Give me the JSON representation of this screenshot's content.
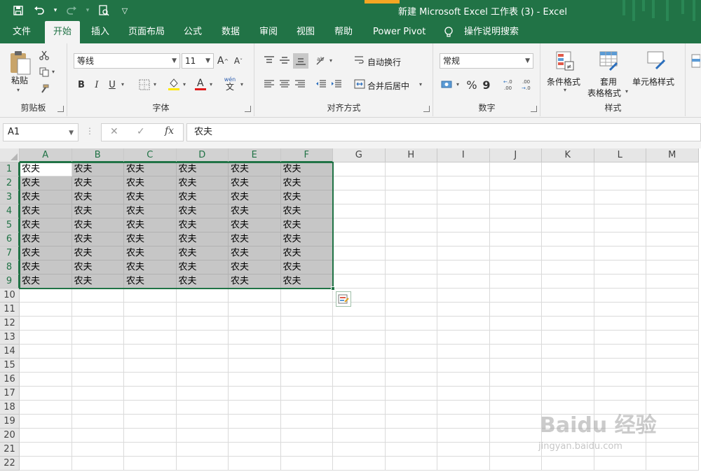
{
  "app": {
    "window_title": "新建 Microsoft Excel 工作表 (3)  -  Excel",
    "brand_color": "#217346"
  },
  "quick_access": [
    {
      "name": "save-icon",
      "glyph": "💾"
    },
    {
      "name": "undo-icon",
      "glyph": "↶"
    },
    {
      "name": "redo-icon",
      "glyph": "↷"
    },
    {
      "name": "print-preview-icon",
      "glyph": "🔍"
    },
    {
      "name": "customize-qat-icon",
      "glyph": "▽"
    }
  ],
  "tabs": [
    "文件",
    "开始",
    "插入",
    "页面布局",
    "公式",
    "数据",
    "审阅",
    "视图",
    "帮助",
    "Power Pivot"
  ],
  "active_tab": "开始",
  "tell_me": "操作说明搜索",
  "ribbon": {
    "clipboard": {
      "label": "剪贴板",
      "paste": "粘贴"
    },
    "font": {
      "label": "字体",
      "font_name": "等线",
      "font_size": "11",
      "bold": "B",
      "italic": "I",
      "underline": "U",
      "grow": "A",
      "shrink": "A",
      "phonetic_top": "wén",
      "phonetic_bottom": "文"
    },
    "alignment": {
      "label": "对齐方式",
      "wrap_text": "自动换行",
      "merge_center": "合并后居中"
    },
    "number": {
      "label": "数字",
      "format": "常规",
      "percent": "%",
      "comma": "9",
      "inc_decimal": "←.0\n.00",
      "dec_decimal": ".00\n→.0"
    },
    "styles": {
      "label": "样式",
      "conditional": "条件格式",
      "format_table_1": "套用",
      "format_table_2": "表格格式",
      "cell_styles": "单元格样式"
    }
  },
  "formula_bar": {
    "name_box": "A1",
    "cancel": "✕",
    "enter": "✓",
    "fx": "fx",
    "content": "农夫"
  },
  "sheet": {
    "columns": [
      "A",
      "B",
      "C",
      "D",
      "E",
      "F",
      "G",
      "H",
      "I",
      "J",
      "K",
      "L",
      "M"
    ],
    "rows": [
      "1",
      "2",
      "3",
      "4",
      "5",
      "6",
      "7",
      "8",
      "9",
      "10",
      "11",
      "12",
      "13",
      "14",
      "15",
      "16",
      "17",
      "18",
      "19",
      "20",
      "21",
      "22"
    ],
    "cells": [
      [
        "农夫",
        "农夫",
        "农夫",
        "农夫",
        "农夫",
        "农夫"
      ],
      [
        "农夫",
        "农夫",
        "农夫",
        "农夫",
        "农夫",
        "农夫"
      ],
      [
        "农夫",
        "农夫",
        "农夫",
        "农夫",
        "农夫",
        "农夫"
      ],
      [
        "农夫",
        "农夫",
        "农夫",
        "农夫",
        "农夫",
        "农夫"
      ],
      [
        "农夫",
        "农夫",
        "农夫",
        "农夫",
        "农夫",
        "农夫"
      ],
      [
        "农夫",
        "农夫",
        "农夫",
        "农夫",
        "农夫",
        "农夫"
      ],
      [
        "农夫",
        "农夫",
        "农夫",
        "农夫",
        "农夫",
        "农夫"
      ],
      [
        "农夫",
        "农夫",
        "农夫",
        "农夫",
        "农夫",
        "农夫"
      ],
      [
        "农夫",
        "农夫",
        "农夫",
        "农夫",
        "农夫",
        "农夫"
      ]
    ],
    "selection": "A1:F9",
    "active_cell": "A1"
  },
  "watermark": {
    "main": "Baidu 经验",
    "sub": "jingyan.baidu.com"
  }
}
